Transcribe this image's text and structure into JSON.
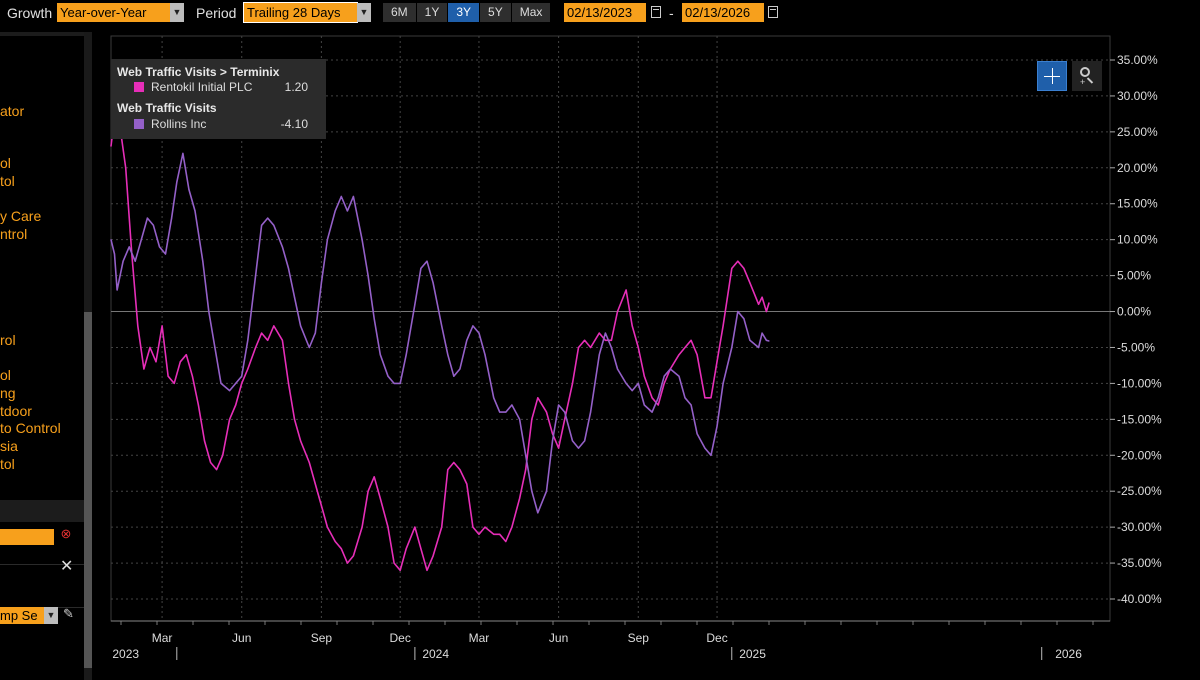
{
  "toolbar": {
    "growth_label": "Growth",
    "growth_value": "Year-over-Year",
    "period_label": "Period",
    "period_value": "Trailing 28 Days",
    "ranges": [
      "6M",
      "1Y",
      "3Y",
      "5Y",
      "Max"
    ],
    "active_range": "3Y",
    "start_date": "02/13/2023",
    "date_separator": "-",
    "end_date": "02/13/2026"
  },
  "left_panel": {
    "items": [
      "ator",
      "ol",
      "tol",
      "y Care",
      "ntrol",
      "rol",
      "ol",
      "ng",
      "tdoor",
      "to Control",
      "sia",
      "tol"
    ],
    "input_value": "mp Se"
  },
  "chart_data": {
    "type": "line",
    "x_domain": [
      "2023-01-15",
      "2026-02-13"
    ],
    "y_domain": [
      -40,
      35
    ],
    "y_ticks": [
      "35.00%",
      "30.00%",
      "25.00%",
      "20.00%",
      "15.00%",
      "10.00%",
      "5.00%",
      "0.00%",
      "-5.00%",
      "-10.00%",
      "-15.00%",
      "-20.00%",
      "-25.00%",
      "-30.00%",
      "-35.00%",
      "-40.00%"
    ],
    "y_tick_values": [
      35,
      30,
      25,
      20,
      15,
      10,
      5,
      0,
      -5,
      -10,
      -15,
      -20,
      -25,
      -30,
      -35,
      -40
    ],
    "month_ticks": [
      {
        "label": "Mar",
        "date": "2023-03-15"
      },
      {
        "label": "Jun",
        "date": "2023-06-15"
      },
      {
        "label": "Sep",
        "date": "2023-09-15"
      },
      {
        "label": "Dec",
        "date": "2023-12-15"
      },
      {
        "label": "Mar",
        "date": "2024-03-15"
      },
      {
        "label": "Jun",
        "date": "2024-06-15"
      },
      {
        "label": "Sep",
        "date": "2024-09-15"
      },
      {
        "label": "Dec",
        "date": "2024-12-15"
      }
    ],
    "year_labels": [
      {
        "label": "2023",
        "date": "2023-02-01"
      },
      {
        "label": "2024",
        "date": "2024-01-25"
      },
      {
        "label": "2025",
        "date": "2025-01-25"
      },
      {
        "label": "2026",
        "date": "2026-01-25"
      }
    ],
    "year_dividers": [
      "2023-04-01",
      "2024-01-01",
      "2025-01-01",
      "2025-12-25"
    ],
    "legend": [
      {
        "title": "Web Traffic Visits > Terminix",
        "name": "Rentokil Initial PLC",
        "value": "1.20",
        "color": "#e62eb8"
      },
      {
        "title": "Web Traffic Visits",
        "name": "Rollins Inc",
        "value": "-4.10",
        "color": "#9460c8"
      }
    ],
    "series": [
      {
        "name": "Rentokil Initial PLC",
        "color": "#e62eb8",
        "points": [
          [
            "2023-01-15",
            23
          ],
          [
            "2023-01-19",
            27
          ],
          [
            "2023-01-25",
            26
          ],
          [
            "2023-02-01",
            20
          ],
          [
            "2023-02-08",
            8
          ],
          [
            "2023-02-15",
            -2
          ],
          [
            "2023-02-22",
            -8
          ],
          [
            "2023-03-01",
            -5
          ],
          [
            "2023-03-08",
            -7
          ],
          [
            "2023-03-15",
            -2
          ],
          [
            "2023-03-22",
            -9
          ],
          [
            "2023-03-29",
            -10
          ],
          [
            "2023-04-05",
            -7
          ],
          [
            "2023-04-12",
            -6
          ],
          [
            "2023-04-19",
            -9
          ],
          [
            "2023-04-26",
            -13
          ],
          [
            "2023-05-03",
            -18
          ],
          [
            "2023-05-10",
            -21
          ],
          [
            "2023-05-17",
            -22
          ],
          [
            "2023-05-24",
            -20
          ],
          [
            "2023-06-01",
            -15
          ],
          [
            "2023-06-08",
            -13
          ],
          [
            "2023-06-15",
            -10
          ],
          [
            "2023-06-22",
            -8
          ],
          [
            "2023-07-01",
            -5
          ],
          [
            "2023-07-08",
            -3
          ],
          [
            "2023-07-15",
            -4
          ],
          [
            "2023-07-22",
            -2
          ],
          [
            "2023-08-01",
            -4
          ],
          [
            "2023-08-08",
            -10
          ],
          [
            "2023-08-15",
            -15
          ],
          [
            "2023-08-22",
            -18
          ],
          [
            "2023-09-01",
            -21
          ],
          [
            "2023-09-08",
            -24
          ],
          [
            "2023-09-15",
            -27
          ],
          [
            "2023-09-22",
            -30
          ],
          [
            "2023-10-01",
            -32
          ],
          [
            "2023-10-08",
            -33
          ],
          [
            "2023-10-15",
            -35
          ],
          [
            "2023-10-22",
            -34
          ],
          [
            "2023-11-01",
            -30
          ],
          [
            "2023-11-08",
            -25
          ],
          [
            "2023-11-15",
            -23
          ],
          [
            "2023-11-22",
            -26
          ],
          [
            "2023-12-01",
            -30
          ],
          [
            "2023-12-08",
            -35
          ],
          [
            "2023-12-15",
            -36
          ],
          [
            "2023-12-22",
            -33
          ],
          [
            "2024-01-01",
            -30
          ],
          [
            "2024-01-08",
            -33
          ],
          [
            "2024-01-15",
            -36
          ],
          [
            "2024-01-22",
            -34
          ],
          [
            "2024-02-01",
            -30
          ],
          [
            "2024-02-08",
            -22
          ],
          [
            "2024-02-15",
            -21
          ],
          [
            "2024-02-22",
            -22
          ],
          [
            "2024-03-01",
            -24
          ],
          [
            "2024-03-08",
            -30
          ],
          [
            "2024-03-15",
            -31
          ],
          [
            "2024-03-22",
            -30
          ],
          [
            "2024-04-01",
            -31
          ],
          [
            "2024-04-08",
            -31
          ],
          [
            "2024-04-15",
            -32
          ],
          [
            "2024-04-22",
            -30
          ],
          [
            "2024-05-01",
            -26
          ],
          [
            "2024-05-08",
            -22
          ],
          [
            "2024-05-15",
            -15
          ],
          [
            "2024-05-22",
            -12
          ],
          [
            "2024-06-01",
            -14
          ],
          [
            "2024-06-08",
            -17
          ],
          [
            "2024-06-15",
            -19
          ],
          [
            "2024-06-22",
            -15
          ],
          [
            "2024-07-01",
            -10
          ],
          [
            "2024-07-08",
            -5
          ],
          [
            "2024-07-15",
            -4
          ],
          [
            "2024-07-22",
            -5
          ],
          [
            "2024-08-01",
            -3
          ],
          [
            "2024-08-08",
            -4
          ],
          [
            "2024-08-15",
            -4
          ],
          [
            "2024-08-22",
            0
          ],
          [
            "2024-09-01",
            3
          ],
          [
            "2024-09-08",
            -2
          ],
          [
            "2024-09-15",
            -5
          ],
          [
            "2024-09-22",
            -9
          ],
          [
            "2024-10-01",
            -12
          ],
          [
            "2024-10-08",
            -13
          ],
          [
            "2024-10-15",
            -10
          ],
          [
            "2024-10-22",
            -8
          ],
          [
            "2024-11-01",
            -6
          ],
          [
            "2024-11-08",
            -5
          ],
          [
            "2024-11-15",
            -4
          ],
          [
            "2024-11-22",
            -6
          ],
          [
            "2024-12-01",
            -12
          ],
          [
            "2024-12-08",
            -12
          ],
          [
            "2024-12-15",
            -7
          ],
          [
            "2024-12-22",
            -2
          ],
          [
            "2025-01-01",
            6
          ],
          [
            "2025-01-08",
            7
          ],
          [
            "2025-01-15",
            6
          ],
          [
            "2025-01-22",
            4
          ],
          [
            "2025-02-01",
            1
          ],
          [
            "2025-02-05",
            2
          ],
          [
            "2025-02-10",
            0
          ],
          [
            "2025-02-13",
            1.2
          ]
        ]
      },
      {
        "name": "Rollins Inc",
        "color": "#9460c8",
        "points": [
          [
            "2023-01-15",
            10
          ],
          [
            "2023-01-19",
            8
          ],
          [
            "2023-01-22",
            3
          ],
          [
            "2023-01-29",
            7
          ],
          [
            "2023-02-05",
            9
          ],
          [
            "2023-02-12",
            7
          ],
          [
            "2023-02-19",
            10
          ],
          [
            "2023-02-26",
            13
          ],
          [
            "2023-03-05",
            12
          ],
          [
            "2023-03-12",
            9
          ],
          [
            "2023-03-19",
            8
          ],
          [
            "2023-03-26",
            13
          ],
          [
            "2023-04-01",
            18
          ],
          [
            "2023-04-08",
            22
          ],
          [
            "2023-04-15",
            17
          ],
          [
            "2023-04-22",
            14
          ],
          [
            "2023-05-01",
            7
          ],
          [
            "2023-05-08",
            0
          ],
          [
            "2023-05-15",
            -5
          ],
          [
            "2023-05-22",
            -10
          ],
          [
            "2023-06-01",
            -11
          ],
          [
            "2023-06-08",
            -10
          ],
          [
            "2023-06-15",
            -9
          ],
          [
            "2023-06-22",
            -4
          ],
          [
            "2023-07-01",
            5
          ],
          [
            "2023-07-08",
            12
          ],
          [
            "2023-07-15",
            13
          ],
          [
            "2023-07-22",
            12
          ],
          [
            "2023-08-01",
            9
          ],
          [
            "2023-08-08",
            6
          ],
          [
            "2023-08-15",
            2
          ],
          [
            "2023-08-22",
            -2
          ],
          [
            "2023-09-01",
            -5
          ],
          [
            "2023-09-08",
            -3
          ],
          [
            "2023-09-15",
            4
          ],
          [
            "2023-09-22",
            10
          ],
          [
            "2023-10-01",
            14
          ],
          [
            "2023-10-08",
            16
          ],
          [
            "2023-10-15",
            14
          ],
          [
            "2023-10-22",
            16
          ],
          [
            "2023-11-01",
            10
          ],
          [
            "2023-11-08",
            5
          ],
          [
            "2023-11-15",
            -1
          ],
          [
            "2023-11-22",
            -6
          ],
          [
            "2023-12-01",
            -9
          ],
          [
            "2023-12-08",
            -10
          ],
          [
            "2023-12-15",
            -10
          ],
          [
            "2023-12-22",
            -6
          ],
          [
            "2024-01-01",
            1
          ],
          [
            "2024-01-08",
            6
          ],
          [
            "2024-01-15",
            7
          ],
          [
            "2024-01-22",
            4
          ],
          [
            "2024-02-01",
            -2
          ],
          [
            "2024-02-08",
            -6
          ],
          [
            "2024-02-15",
            -9
          ],
          [
            "2024-02-22",
            -8
          ],
          [
            "2024-03-01",
            -4
          ],
          [
            "2024-03-08",
            -2
          ],
          [
            "2024-03-15",
            -3
          ],
          [
            "2024-03-22",
            -6
          ],
          [
            "2024-04-01",
            -12
          ],
          [
            "2024-04-08",
            -14
          ],
          [
            "2024-04-15",
            -14
          ],
          [
            "2024-04-22",
            -13
          ],
          [
            "2024-05-01",
            -15
          ],
          [
            "2024-05-08",
            -20
          ],
          [
            "2024-05-15",
            -25
          ],
          [
            "2024-05-22",
            -28
          ],
          [
            "2024-06-01",
            -25
          ],
          [
            "2024-06-08",
            -18
          ],
          [
            "2024-06-15",
            -13
          ],
          [
            "2024-06-22",
            -14
          ],
          [
            "2024-07-01",
            -18
          ],
          [
            "2024-07-08",
            -19
          ],
          [
            "2024-07-15",
            -18
          ],
          [
            "2024-07-22",
            -14
          ],
          [
            "2024-08-01",
            -6
          ],
          [
            "2024-08-08",
            -3
          ],
          [
            "2024-08-15",
            -5
          ],
          [
            "2024-08-22",
            -8
          ],
          [
            "2024-09-01",
            -10
          ],
          [
            "2024-09-08",
            -11
          ],
          [
            "2024-09-15",
            -10
          ],
          [
            "2024-09-22",
            -13
          ],
          [
            "2024-10-01",
            -14
          ],
          [
            "2024-10-08",
            -12
          ],
          [
            "2024-10-15",
            -9
          ],
          [
            "2024-10-22",
            -8
          ],
          [
            "2024-11-01",
            -9
          ],
          [
            "2024-11-08",
            -12
          ],
          [
            "2024-11-15",
            -13
          ],
          [
            "2024-11-22",
            -17
          ],
          [
            "2024-12-01",
            -19
          ],
          [
            "2024-12-08",
            -20
          ],
          [
            "2024-12-15",
            -16
          ],
          [
            "2024-12-22",
            -10
          ],
          [
            "2025-01-01",
            -5
          ],
          [
            "2025-01-08",
            0
          ],
          [
            "2025-01-15",
            -1
          ],
          [
            "2025-01-22",
            -4
          ],
          [
            "2025-02-01",
            -5
          ],
          [
            "2025-02-05",
            -3
          ],
          [
            "2025-02-10",
            -4
          ],
          [
            "2025-02-13",
            -4.1
          ]
        ]
      }
    ]
  }
}
